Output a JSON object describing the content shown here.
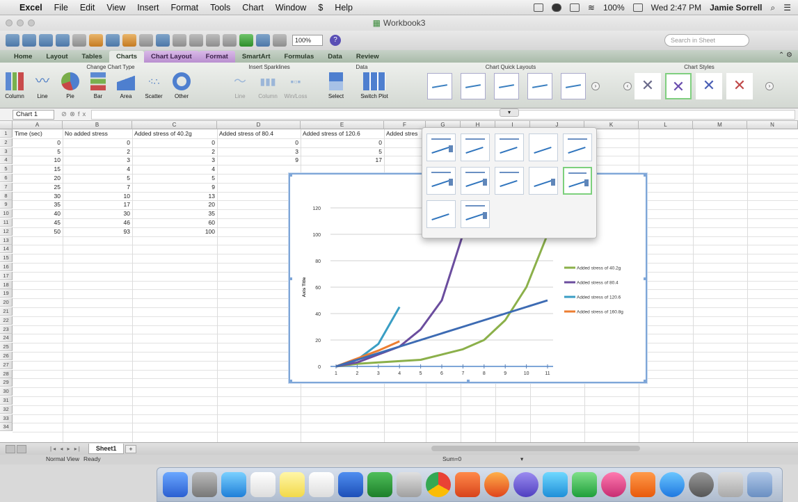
{
  "menubar": {
    "app": "Excel",
    "items": [
      "File",
      "Edit",
      "View",
      "Insert",
      "Format",
      "Tools",
      "Chart",
      "Window",
      "Help"
    ],
    "battery": "100%",
    "clock": "Wed 2:47 PM",
    "user": "Jamie Sorrell"
  },
  "window": {
    "title": "Workbook3"
  },
  "toolbar": {
    "zoom": "100%",
    "search_placeholder": "Search in Sheet"
  },
  "ribbon": {
    "tabs": [
      "Home",
      "Layout",
      "Tables",
      "Charts",
      "Chart Layout",
      "Format",
      "SmartArt",
      "Formulas",
      "Data",
      "Review"
    ],
    "groups": {
      "change_chart_type": "Change Chart Type",
      "insert_sparklines": "Insert Sparklines",
      "data": "Data",
      "quick_layouts": "Chart Quick Layouts",
      "chart_styles": "Chart Styles"
    },
    "buttons": {
      "column": "Column",
      "line": "Line",
      "pie": "Pie",
      "bar": "Bar",
      "area": "Area",
      "scatter": "Scatter",
      "other": "Other",
      "spark_line": "Line",
      "spark_column": "Column",
      "spark_winloss": "Win/Loss",
      "select": "Select",
      "switch_plot": "Switch Plot"
    }
  },
  "formula_bar": {
    "name_box": "Chart 1"
  },
  "sheet": {
    "columns": [
      "A",
      "B",
      "C",
      "D",
      "E",
      "F",
      "G",
      "H",
      "I",
      "J",
      "K",
      "L",
      "M",
      "N"
    ],
    "rows": [
      "1",
      "2",
      "3",
      "4",
      "5",
      "6",
      "7",
      "8",
      "9",
      "10",
      "11",
      "12",
      "13",
      "14",
      "15",
      "16",
      "17",
      "18",
      "19",
      "20",
      "21",
      "22",
      "23",
      "24",
      "25",
      "26",
      "27",
      "28",
      "29",
      "30",
      "31",
      "32",
      "33",
      "34"
    ],
    "headers": [
      "Time (sec)",
      "No added stress",
      "Added stress of 40.2g",
      "Added stress of 80.4",
      "Added stress of 120.6",
      "Added stres"
    ],
    "colA": [
      "0",
      "5",
      "10",
      "15",
      "20",
      "25",
      "30",
      "35",
      "40",
      "45",
      "50"
    ],
    "colB": [
      "0",
      "2",
      "3",
      "4",
      "5",
      "7",
      "10",
      "17",
      "30",
      "46",
      "93"
    ],
    "colC": [
      "0",
      "2",
      "3",
      "4",
      "5",
      "9",
      "13",
      "20",
      "35",
      "60",
      "100"
    ],
    "colD": [
      "0",
      "3",
      "9"
    ],
    "colE": [
      "0",
      "5",
      "17"
    ]
  },
  "chart_data": {
    "type": "line",
    "x": [
      "1",
      "2",
      "3",
      "4",
      "5",
      "6",
      "7",
      "8",
      "9",
      "10",
      "11"
    ],
    "ylabel": "Axis Title",
    "ylim": [
      0,
      120
    ],
    "y_ticks": [
      "0",
      "20",
      "40",
      "60",
      "80",
      "100",
      "120"
    ],
    "legend_position": "right",
    "series": [
      {
        "name": "Added stress of 40.2g",
        "color": "#8bb04a",
        "values": [
          0,
          2,
          3,
          4,
          5,
          9,
          13,
          20,
          35,
          60,
          100
        ]
      },
      {
        "name": "Added stress of 80.4",
        "color": "#6b4d9e",
        "values": [
          0,
          3,
          9,
          15,
          28,
          50,
          100,
          140
        ]
      },
      {
        "name": "Added stress of 120.6",
        "color": "#3a9ec4",
        "values": [
          0,
          5,
          17,
          45
        ]
      },
      {
        "name": "Added stress of 160.8g",
        "color": "#ec7e31",
        "values": [
          0,
          6,
          12,
          19
        ]
      },
      {
        "name": "",
        "color": "#3d6bb3",
        "values": [
          0,
          5,
          10,
          15,
          20,
          25,
          30,
          35,
          40,
          45,
          50
        ]
      }
    ]
  },
  "sheet_tab": {
    "name": "Sheet1",
    "add": "+"
  },
  "status": {
    "view": "Normal View",
    "ready": "Ready",
    "sum": "Sum=0"
  }
}
